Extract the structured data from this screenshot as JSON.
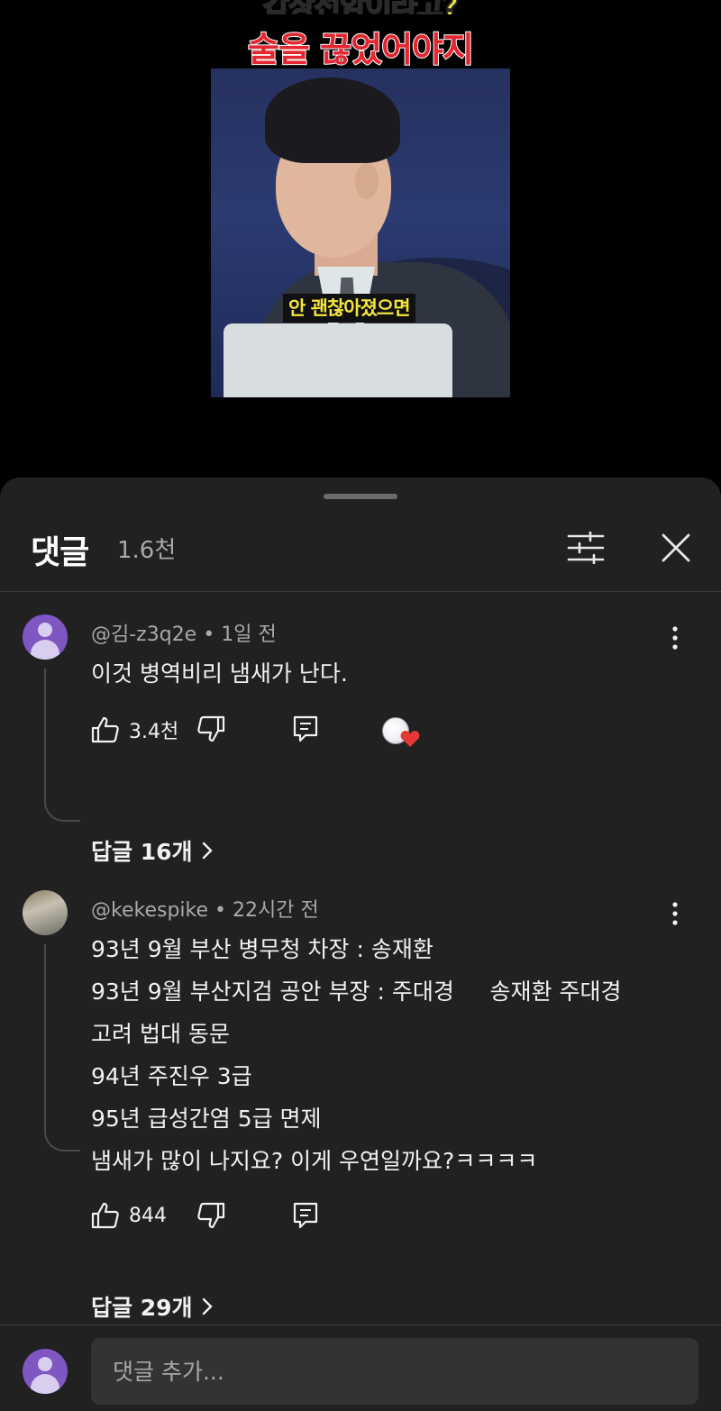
{
  "video": {
    "caption_top": "갑상선암이라고?",
    "caption_red": "술을 끊었어야지",
    "subtitle": "안 괜찮아졌으면"
  },
  "comments_panel": {
    "title": "댓글",
    "count": "1.6천",
    "filter_icon": "sliders-icon",
    "close_icon": "close-icon"
  },
  "comments": [
    {
      "author": "@김-z3q2e",
      "time": "1일 전",
      "lines": [
        "이것 병역비리 냄새가 난다."
      ],
      "likes": "3.4천",
      "creator_hearted": true,
      "replies_label": "답글 16개"
    },
    {
      "author": "@kekespike",
      "time": "22시간 전",
      "lines": [
        "93년 9월 부산 병무청 차장 : 송재환",
        "93년 9월 부산지검 공안 부장 : 주대경     송재환 주대경",
        "고려 법대 동문",
        "94년 주진우 3급",
        "95년 급성간염 5급 면제",
        "냄새가 많이 나지요? 이게 우연일까요?ㅋㅋㅋㅋ"
      ],
      "likes": "844",
      "creator_hearted": false,
      "replies_label": "답글 29개"
    }
  ],
  "composer": {
    "placeholder": "댓글 추가..."
  },
  "colors": {
    "panel_bg": "#212121",
    "avatar_purple": "#7e57c2",
    "heart_red": "#e53935",
    "caption_red": "#e3262f",
    "subtitle_yellow": "#f2e43a"
  }
}
